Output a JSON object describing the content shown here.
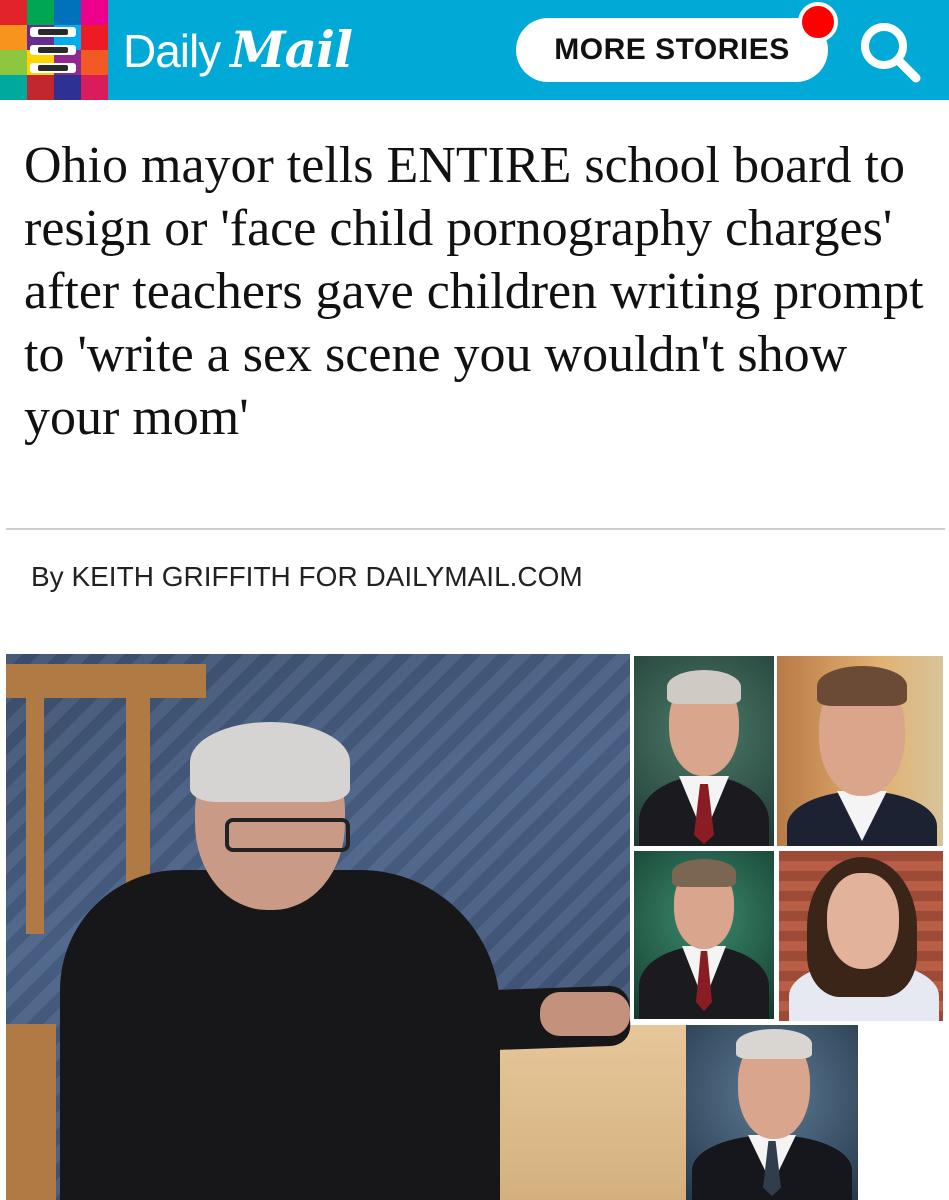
{
  "header": {
    "logo_daily": "Daily",
    "logo_mail": "Mail",
    "more_stories_label": "MORE STORIES",
    "menu_icon": "hamburger-menu-icon",
    "search_icon": "search-icon",
    "brand_color": "#00a9d6",
    "notification_color": "#ff0000"
  },
  "article": {
    "headline": "Ohio mayor tells ENTIRE school board to resign or 'face child pornography charges' after teachers gave children writing prompt to 'write a sex scene you wouldn't show your mom'",
    "byline": "By KEITH GRIFFITH FOR DAILYMAIL.COM"
  },
  "mosaic_colors": [
    "#e3232b",
    "#00a651",
    "#0072bc",
    "#ec008c",
    "#f7941d",
    "#662d91",
    "#00aeef",
    "#ed1c24",
    "#8dc63f",
    "#ffd400",
    "#92278f",
    "#f15a24",
    "#00a99d",
    "#c1272d",
    "#2e3192",
    "#d91c5c"
  ]
}
